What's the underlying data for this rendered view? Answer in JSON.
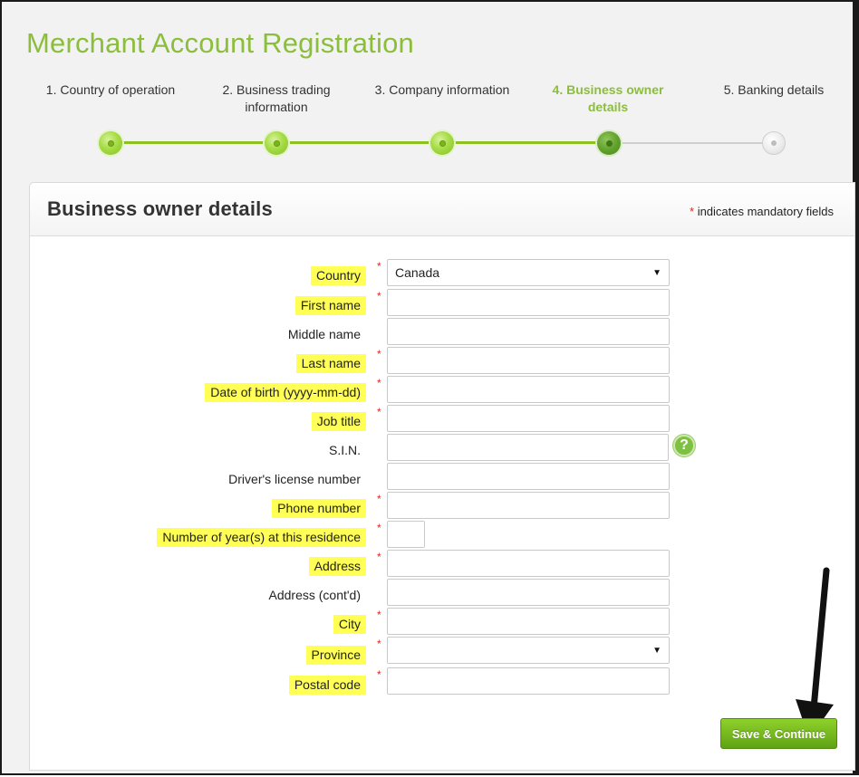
{
  "page": {
    "title": "Merchant Account Registration",
    "accent": "#8bbe3a"
  },
  "steps": [
    {
      "label": "1. Country of operation",
      "state": "done"
    },
    {
      "label": "2. Business trading information",
      "state": "done"
    },
    {
      "label": "3. Company information",
      "state": "done"
    },
    {
      "label": "4. Business owner details",
      "state": "current"
    },
    {
      "label": "5. Banking details",
      "state": "todo"
    }
  ],
  "panel": {
    "title": "Business owner details",
    "mandatory_star": "*",
    "mandatory_note": "indicates mandatory fields"
  },
  "form": {
    "required_marker": "*",
    "country": {
      "label": "Country",
      "value": "Canada"
    },
    "first_name": {
      "label": "First name",
      "value": ""
    },
    "middle_name": {
      "label": "Middle name",
      "value": ""
    },
    "last_name": {
      "label": "Last name",
      "value": ""
    },
    "dob": {
      "label": "Date of birth (yyyy-mm-dd)",
      "value": ""
    },
    "job_title": {
      "label": "Job title",
      "value": ""
    },
    "sin": {
      "label": "S.I.N.",
      "value": "",
      "help_icon": "?"
    },
    "drivers_license": {
      "label": "Driver's license number",
      "value": ""
    },
    "phone": {
      "label": "Phone number",
      "value": ""
    },
    "years_residence": {
      "label": "Number of year(s) at this residence",
      "value": ""
    },
    "address": {
      "label": "Address",
      "value": ""
    },
    "address2": {
      "label": "Address (cont'd)",
      "value": ""
    },
    "city": {
      "label": "City",
      "value": ""
    },
    "province": {
      "label": "Province",
      "value": ""
    },
    "postal_code": {
      "label": "Postal code",
      "value": ""
    }
  },
  "actions": {
    "save_label": "Save & Continue"
  },
  "icons": {
    "help": "help-circle-icon",
    "caret": "chevron-down-icon",
    "annotation": "arrow-down-icon"
  }
}
